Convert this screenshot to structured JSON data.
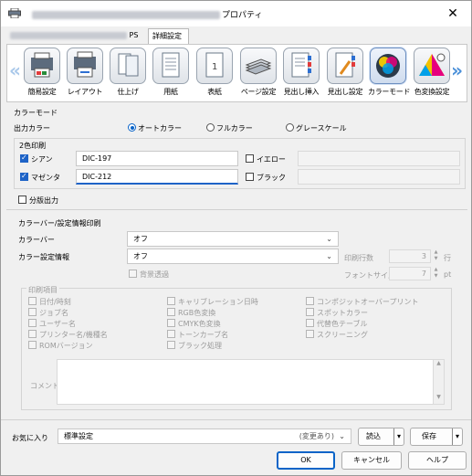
{
  "window": {
    "title_suffix": "プロパティ",
    "close_glyph": "✕"
  },
  "tabs": {
    "ps_label": "PS",
    "advanced_label": "詳細設定"
  },
  "icon_bar": {
    "prev_glyph": "«",
    "next_glyph": "»",
    "items": [
      {
        "label": "簡易設定",
        "icon": "quick-setup-icon"
      },
      {
        "label": "レイアウト",
        "icon": "layout-icon"
      },
      {
        "label": "仕上げ",
        "icon": "finishing-icon"
      },
      {
        "label": "用紙",
        "icon": "paper-icon"
      },
      {
        "label": "表紙",
        "icon": "cover-icon"
      },
      {
        "label": "ページ設定",
        "icon": "page-setting-icon"
      },
      {
        "label": "見出し挿入",
        "icon": "tab-insert-icon"
      },
      {
        "label": "見出し設定",
        "icon": "tab-setting-icon"
      },
      {
        "label": "カラーモード",
        "icon": "color-mode-icon"
      },
      {
        "label": "色変換設定",
        "icon": "color-conversion-icon"
      }
    ]
  },
  "color_mode": {
    "section_label": "カラーモード",
    "output_label": "出力カラー",
    "options": [
      "オートカラー",
      "フルカラー",
      "グレースケール"
    ],
    "selected": "オートカラー"
  },
  "two_color": {
    "label": "2色印刷",
    "cyan": {
      "label": "シアン",
      "value": "DIC-197",
      "checked": true
    },
    "magenta": {
      "label": "マゼンタ",
      "value": "DIC-212",
      "checked": true
    },
    "yellow": {
      "label": "イエロー",
      "value": "",
      "checked": false
    },
    "black": {
      "label": "ブラック",
      "value": "",
      "checked": false
    }
  },
  "separation": {
    "label": "分版出力",
    "checked": false
  },
  "color_bar": {
    "section_label": "カラーバー/設定情報印刷",
    "bar_label": "カラーバー",
    "bar_value": "オフ",
    "info_label": "カラー設定情報",
    "info_value": "オフ",
    "print_lines_label": "印刷行数",
    "print_lines_value": "3",
    "print_lines_unit": "行",
    "font_size_label": "フォントサイズ",
    "font_size_value": "7",
    "font_size_unit": "pt",
    "transparent_bg_label": "背景透過"
  },
  "print_items": {
    "label": "印刷項目",
    "col1": [
      "日付/時刻",
      "ジョブ名",
      "ユーザー名",
      "プリンター名/機種名",
      "ROMバージョン"
    ],
    "col2": [
      "キャリブレーション日時",
      "RGB色変換",
      "CMYK色変換",
      "トーンカーブ名",
      "ブラック処理"
    ],
    "col3": [
      "コンポジットオーバープリント",
      "スポットカラー",
      "代替色テーブル",
      "スクリーニング"
    ],
    "comment_label": "コメント"
  },
  "favorites": {
    "label": "お気に入り",
    "value": "標準設定",
    "changed_tag": "(変更あり)",
    "load_label": "読込",
    "save_label": "保存"
  },
  "footer": {
    "ok": "OK",
    "cancel": "キャンセル",
    "help": "ヘルプ"
  },
  "colors": {
    "accent": "#0a64c8",
    "checkbox": "#1e63c7"
  }
}
